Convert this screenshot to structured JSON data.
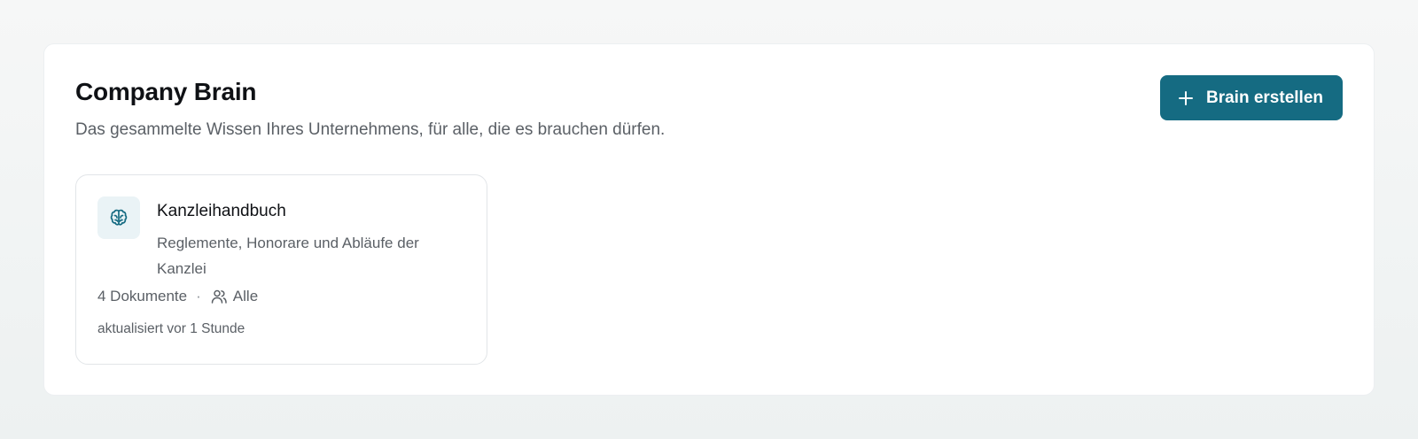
{
  "header": {
    "title": "Company Brain",
    "subtitle": "Das gesammelte Wissen Ihres Unternehmens, für alle, die es brauchen dürfen."
  },
  "actions": {
    "create_label": "Brain erstellen",
    "create_icon": "plus-icon"
  },
  "brains": [
    {
      "icon": "brain-icon",
      "title": "Kanzleihandbuch",
      "description": "Reglemente, Honorare und Abläufe der Kanzlei",
      "documents": "4 Dokumente",
      "separator": "·",
      "access_icon": "users-icon",
      "access": "Alle",
      "updated": "aktualisiert vor 1 Stunde"
    }
  ],
  "colors": {
    "accent": "#156b82",
    "icon_bg": "#eaf3f6"
  }
}
